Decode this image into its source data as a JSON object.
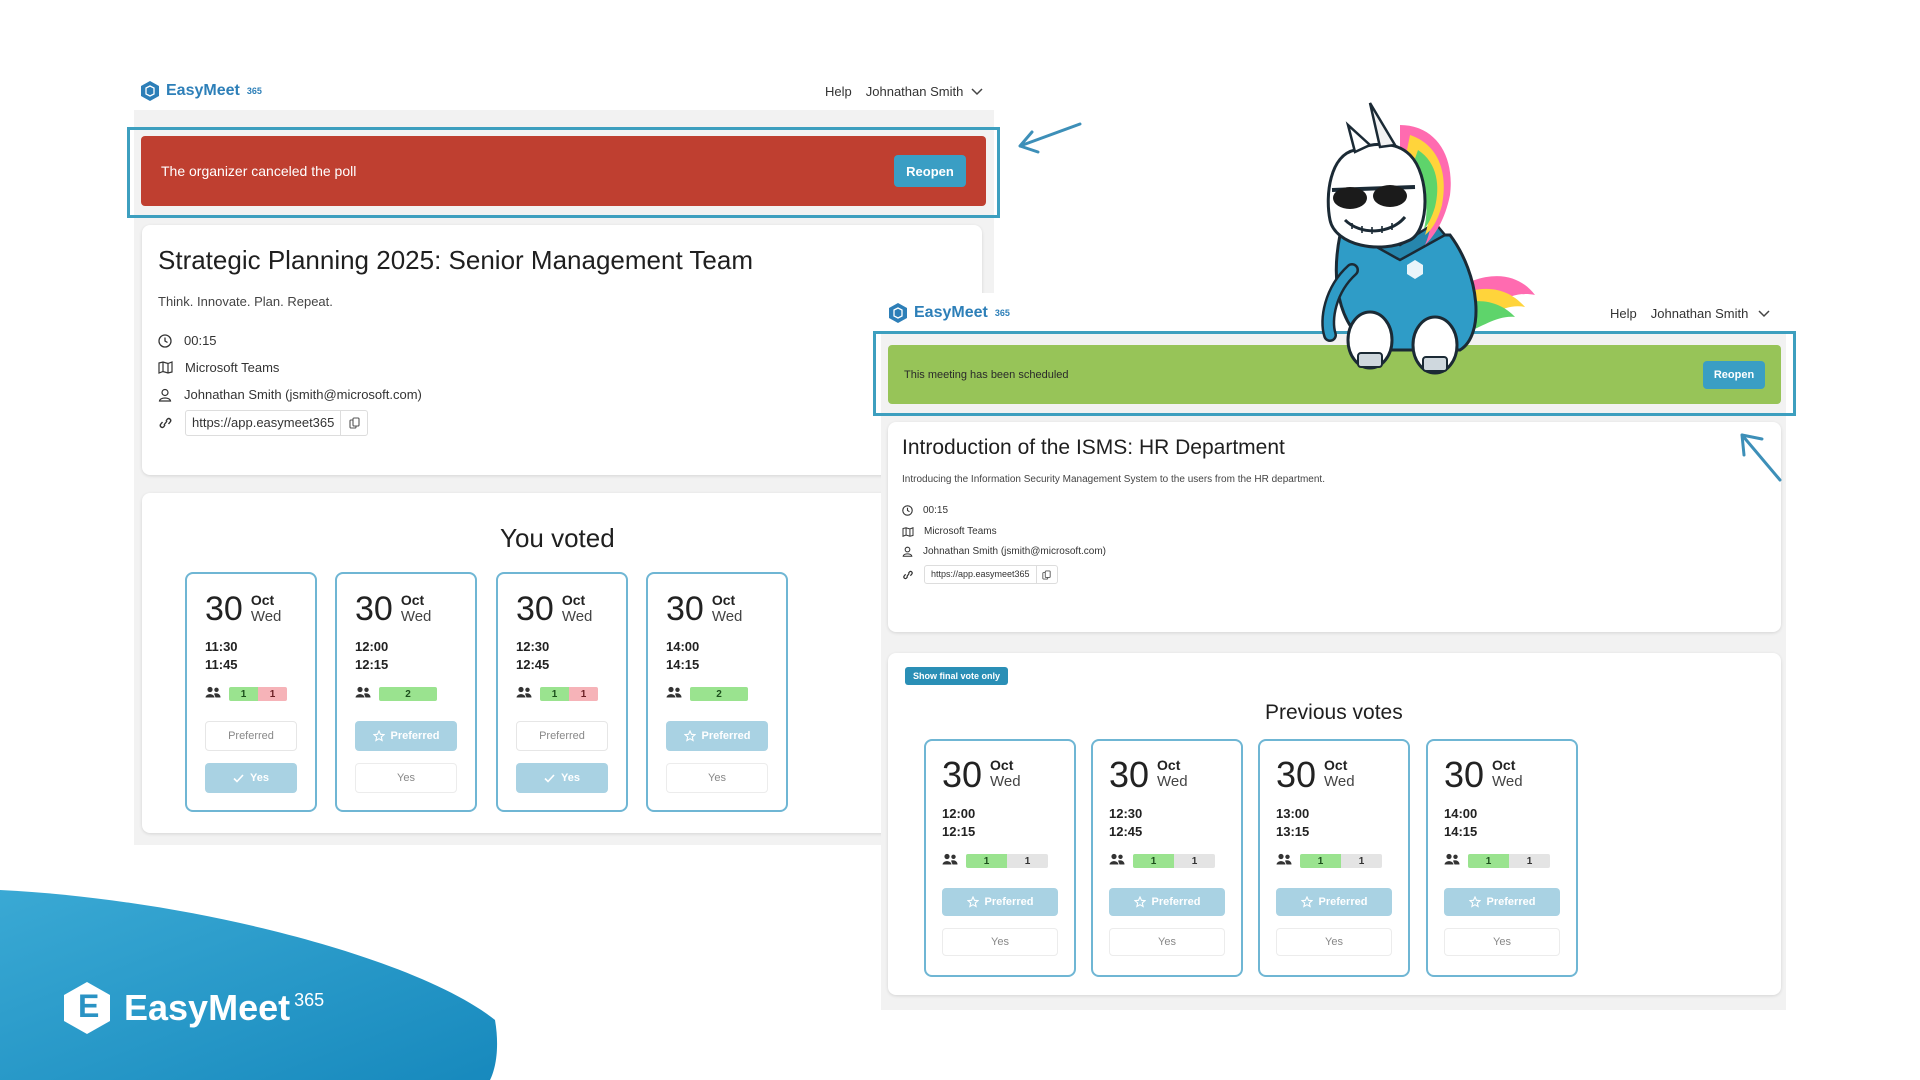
{
  "colors": {
    "accent": "#3a9ec4",
    "canceled": "#bf3f30",
    "scheduled": "#97c458",
    "highlight": "#3d9fbf"
  },
  "left": {
    "logo": {
      "name": "EasyMeet",
      "suffix": "365"
    },
    "nav": {
      "help": "Help",
      "user": "Johnathan Smith"
    },
    "banner": {
      "text": "The organizer canceled the poll",
      "button": "Reopen"
    },
    "event": {
      "title": "Strategic Planning 2025: Senior Management Team",
      "description": "Think. Innovate. Plan. Repeat.",
      "duration": "00:15",
      "location": "Microsoft Teams",
      "organizer": "Johnathan Smith (jsmith@microsoft.com)",
      "link": "https://app.easymeet365"
    },
    "votes_heading": "You voted",
    "slots": [
      {
        "day": "30",
        "month": "Oct",
        "weekday": "Wed",
        "start": "11:30",
        "end": "11:45",
        "yes": "1",
        "no": "1",
        "preferred": "Preferred",
        "preferred_on": false,
        "yes_label": "Yes",
        "yes_on": true
      },
      {
        "day": "30",
        "month": "Oct",
        "weekday": "Wed",
        "start": "12:00",
        "end": "12:15",
        "yes": "2",
        "no": "",
        "preferred": "Preferred",
        "preferred_on": true,
        "yes_label": "Yes",
        "yes_on": false
      },
      {
        "day": "30",
        "month": "Oct",
        "weekday": "Wed",
        "start": "12:30",
        "end": "12:45",
        "yes": "1",
        "no": "1",
        "preferred": "Preferred",
        "preferred_on": false,
        "yes_label": "Yes",
        "yes_on": true
      },
      {
        "day": "30",
        "month": "Oct",
        "weekday": "Wed",
        "start": "14:00",
        "end": "14:15",
        "yes": "2",
        "no": "",
        "preferred": "Preferred",
        "preferred_on": true,
        "yes_label": "Yes",
        "yes_on": false
      }
    ]
  },
  "right": {
    "logo": {
      "name": "EasyMeet",
      "suffix": "365"
    },
    "nav": {
      "help": "Help",
      "user": "Johnathan Smith"
    },
    "banner": {
      "text": "This meeting has been scheduled",
      "button": "Reopen"
    },
    "event": {
      "title": "Introduction of the ISMS: HR Department",
      "description": "Introducing the Information Security Management System to the users from the HR department.",
      "duration": "00:15",
      "location": "Microsoft Teams",
      "organizer": "Johnathan Smith (jsmith@microsoft.com)",
      "link": "https://app.easymeet365"
    },
    "show_final": "Show final vote only",
    "votes_heading": "Previous votes",
    "slots": [
      {
        "day": "30",
        "month": "Oct",
        "weekday": "Wed",
        "start": "12:00",
        "end": "12:15",
        "yes": "1",
        "other": "1",
        "preferred": "Preferred",
        "yes_label": "Yes"
      },
      {
        "day": "30",
        "month": "Oct",
        "weekday": "Wed",
        "start": "12:30",
        "end": "12:45",
        "yes": "1",
        "other": "1",
        "preferred": "Preferred",
        "yes_label": "Yes"
      },
      {
        "day": "30",
        "month": "Oct",
        "weekday": "Wed",
        "start": "13:00",
        "end": "13:15",
        "yes": "1",
        "other": "1",
        "preferred": "Preferred",
        "yes_label": "Yes"
      },
      {
        "day": "30",
        "month": "Oct",
        "weekday": "Wed",
        "start": "14:00",
        "end": "14:15",
        "yes": "1",
        "other": "1",
        "preferred": "Preferred",
        "yes_label": "Yes"
      }
    ]
  },
  "brand": {
    "name": "EasyMeet",
    "suffix": "365",
    "letter": "E"
  }
}
